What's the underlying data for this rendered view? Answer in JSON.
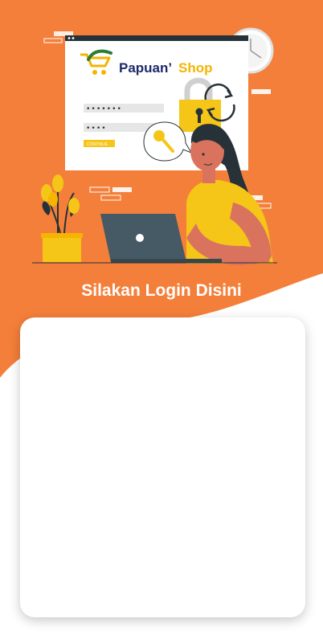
{
  "header": {
    "title": "Silakan Login Disini"
  },
  "illustration": {
    "brand_part1": "Papuan’",
    "brand_part2": "Shop",
    "password_masked": "•••••••",
    "pin_masked": "••••",
    "continue_label": "CONTINUE"
  },
  "login_card": {},
  "colors": {
    "primary": "#F47F3A",
    "accent_yellow": "#F5C518",
    "brand_navy": "#1E2A6B",
    "brand_yellow": "#F5B400",
    "card_bg": "#FFFFFF"
  }
}
